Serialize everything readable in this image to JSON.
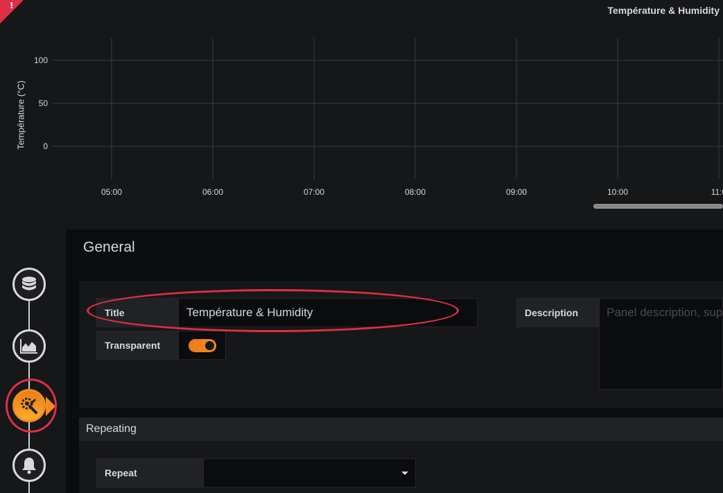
{
  "graph": {
    "title": "Température & Humidity",
    "alert_icon": "exclamation-icon"
  },
  "chart_data": {
    "type": "line",
    "title": "Température & Humidity",
    "ylabel": "Température (°C)",
    "xlabel": "",
    "y_ticks": [
      "100",
      "50",
      "0"
    ],
    "x_ticks": [
      "05:00",
      "06:00",
      "07:00",
      "08:00",
      "09:00",
      "10:00",
      "11:0"
    ],
    "series": [],
    "grid": true
  },
  "wizard": {
    "steps": [
      {
        "icon": "database-icon"
      },
      {
        "icon": "area-chart-icon"
      },
      {
        "icon": "settings-icon",
        "active": true
      },
      {
        "icon": "bell-icon"
      }
    ]
  },
  "editor": {
    "section_title": "General",
    "fields": {
      "title_label": "Title",
      "title_value": "Température & Humidity",
      "transparent_label": "Transparent",
      "transparent_on": true,
      "description_label": "Description",
      "description_placeholder": "Panel description, sup"
    },
    "repeating": {
      "header": "Repeating",
      "repeat_label": "Repeat",
      "repeat_value": ""
    }
  },
  "colors": {
    "background": "#161719",
    "editor_bg": "#0b0c0e",
    "accent": "#f58c1f",
    "annotation_red": "#e02f44"
  }
}
